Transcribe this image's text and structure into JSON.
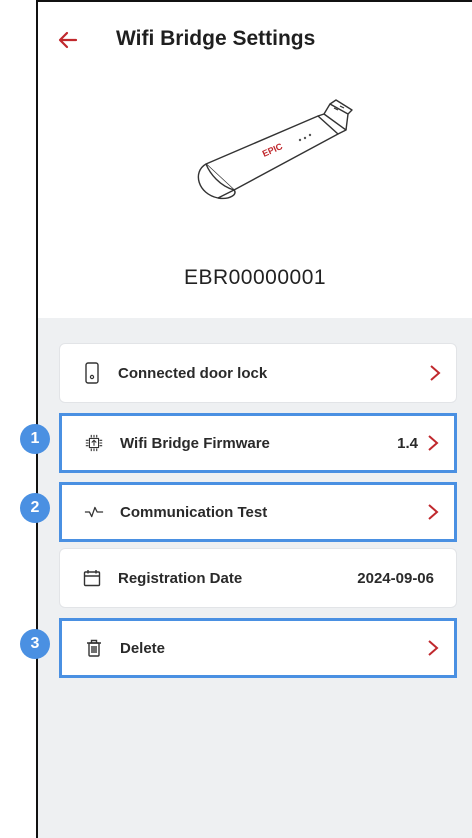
{
  "header": {
    "title": "Wifi Bridge Settings",
    "back_icon": "arrow-left-icon",
    "device_serial": "EBR00000001",
    "device_logo_text": "EPIC"
  },
  "items": [
    {
      "label": "Connected door lock",
      "value": "",
      "icon": "door-lock-icon",
      "has_arrow": true
    },
    {
      "label": "Wifi Bridge Firmware",
      "value": "1.4",
      "icon": "firmware-chip-icon",
      "has_arrow": true
    },
    {
      "label": "Communication Test",
      "value": "",
      "icon": "pulse-icon",
      "has_arrow": true
    },
    {
      "label": "Registration Date",
      "value": "2024-09-06",
      "icon": "calendar-icon",
      "has_arrow": false
    },
    {
      "label": "Delete",
      "value": "",
      "icon": "trash-icon",
      "has_arrow": true
    }
  ],
  "annotations": [
    "1",
    "2",
    "3"
  ],
  "colors": {
    "accent_red": "#c0282d",
    "highlight_blue": "#4a90e2",
    "content_bg": "#eef0f2"
  }
}
